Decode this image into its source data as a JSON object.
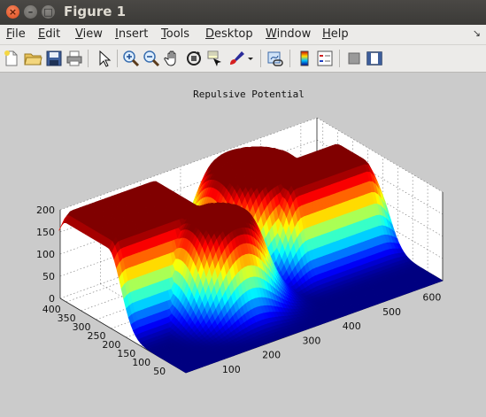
{
  "window": {
    "title": "Figure 1",
    "close_glyph": "×",
    "minimize_glyph": "–",
    "maximize_glyph": "□"
  },
  "menu": {
    "items": [
      {
        "first": "F",
        "rest": "ile"
      },
      {
        "first": "E",
        "rest": "dit"
      },
      {
        "first": "V",
        "rest": "iew"
      },
      {
        "first": "I",
        "rest": "nsert"
      },
      {
        "first": "T",
        "rest": "ools"
      },
      {
        "first": "D",
        "rest": "esktop"
      },
      {
        "first": "W",
        "rest": "indow"
      },
      {
        "first": "H",
        "rest": "elp"
      }
    ],
    "dock_arrow": "↘"
  },
  "toolbar": {
    "icons": [
      "new-file-icon",
      "open-folder-icon",
      "save-icon",
      "print-icon",
      "pointer-icon",
      "zoom-in-icon",
      "zoom-out-icon",
      "pan-hand-icon",
      "rotate-3d-icon",
      "data-cursor-icon",
      "brush-icon",
      "brush-dropdown-icon",
      "link-plot-icon",
      "colorbar-icon",
      "legend-icon",
      "hide-plot-tools-icon",
      "show-plot-tools-icon"
    ]
  },
  "chart_data": {
    "type": "surface",
    "title": "Repulsive Potential",
    "colormap": "jet",
    "grid": true,
    "x_ticks": [
      100,
      200,
      300,
      400,
      500,
      600
    ],
    "y_ticks": [
      50,
      100,
      150,
      200,
      250,
      300,
      350,
      400
    ],
    "z_ticks": [
      0,
      50,
      100,
      150,
      200
    ],
    "xlim": [
      0,
      640
    ],
    "ylim": [
      0,
      420
    ],
    "zlim": [
      0,
      200
    ],
    "obstacles": [
      {
        "shape": "rectangle",
        "x_range": [
          20,
          220
        ],
        "y_range": [
          260,
          400
        ],
        "height": 200
      },
      {
        "shape": "circle",
        "center": [
          230,
          200
        ],
        "radius": 55,
        "height": 200
      },
      {
        "shape": "circle",
        "center": [
          420,
          330
        ],
        "radius": 80,
        "height": 200
      },
      {
        "shape": "rectangle",
        "x_range": [
          430,
          600
        ],
        "y_range": [
          220,
          300
        ],
        "height": 200
      }
    ]
  }
}
